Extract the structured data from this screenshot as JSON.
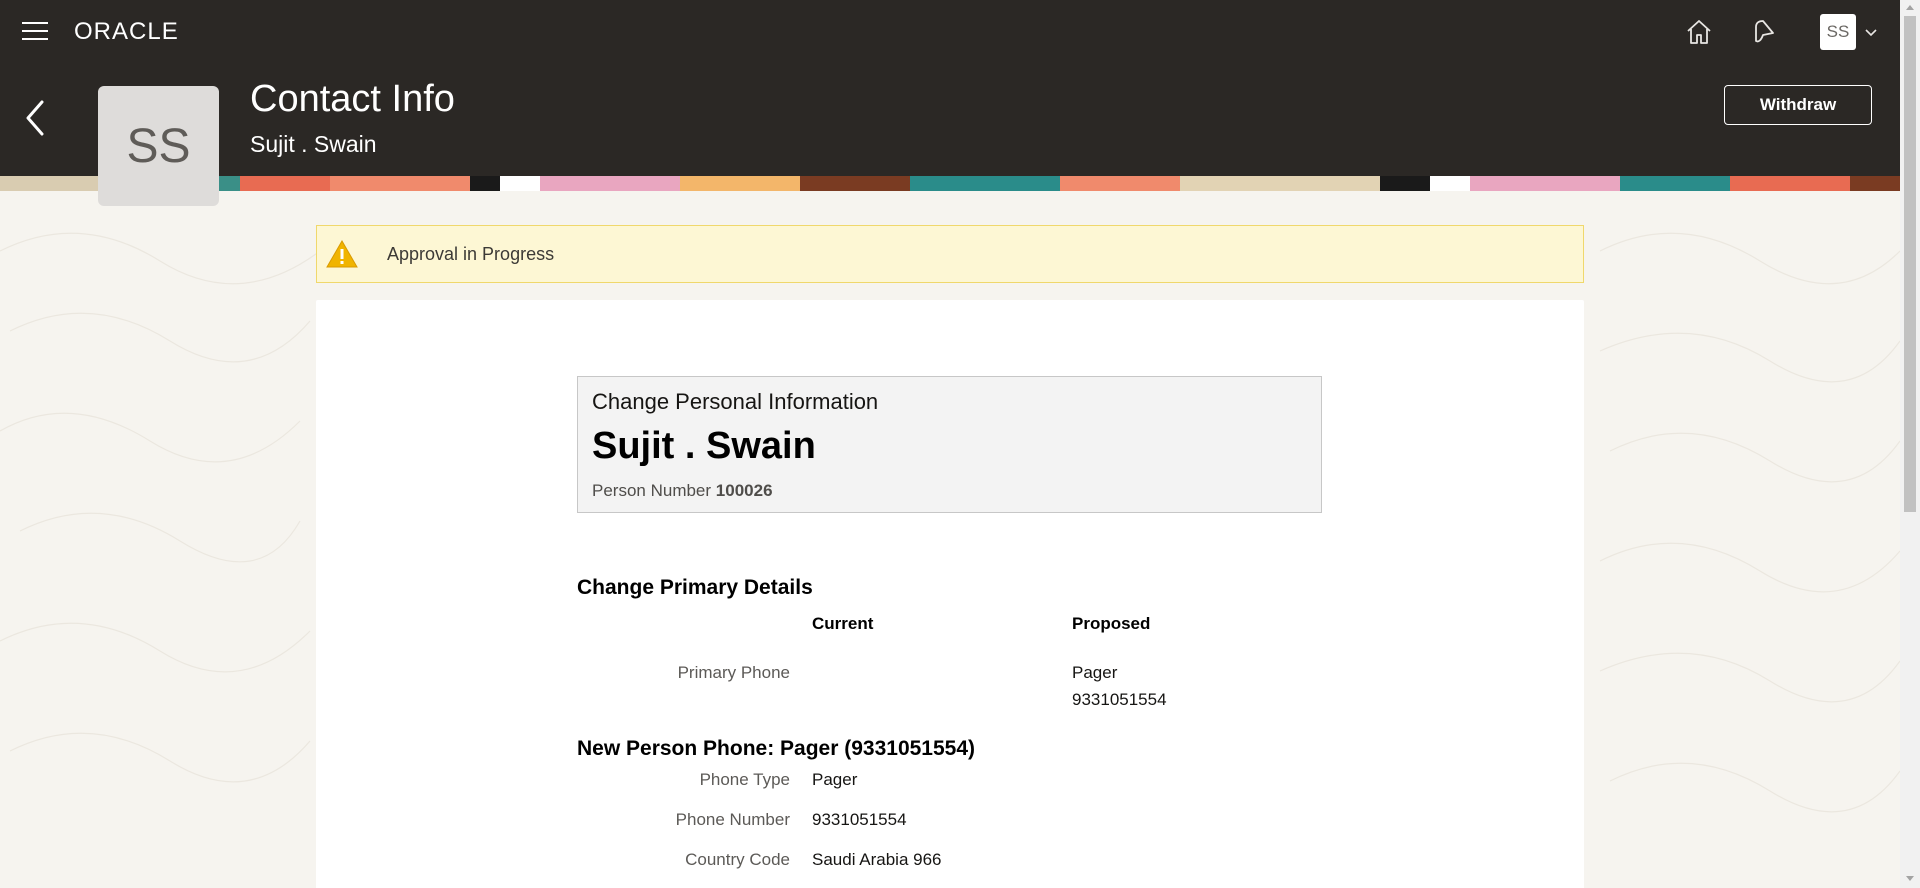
{
  "header": {
    "brand": "ORACLE",
    "page_title": "Contact Info",
    "subtitle": "Sujit . Swain",
    "avatar_initials": "SS",
    "user_initials": "SS",
    "withdraw_label": "Withdraw",
    "icons": [
      "menu-icon",
      "home-icon",
      "notifications-icon",
      "chevron-down-icon",
      "back-icon"
    ]
  },
  "warning": {
    "text": "Approval in Progress",
    "icon": "warning-icon",
    "color": "#f0b400"
  },
  "summary": {
    "heading": "Change Personal Information",
    "name": "Sujit . Swain",
    "person_number_label": "Person Number",
    "person_number": "100026"
  },
  "primary_details": {
    "title": "Change Primary Details",
    "col_current": "Current",
    "col_proposed": "Proposed",
    "rows": [
      {
        "label": "Primary Phone",
        "current": "",
        "proposed_line1": "Pager",
        "proposed_line2": "9331051554"
      }
    ]
  },
  "new_phone": {
    "title": "New Person Phone: Pager (9331051554)",
    "rows": [
      {
        "label": "Phone Type",
        "value": "Pager"
      },
      {
        "label": "Phone Number",
        "value": "9331051554"
      },
      {
        "label": "Country Code",
        "value": "Saudi Arabia 966"
      }
    ]
  },
  "colors": {
    "topbar": "#2b2825",
    "page_bg": "#f6f4ef",
    "warning_bg": "#fdf7d4"
  }
}
